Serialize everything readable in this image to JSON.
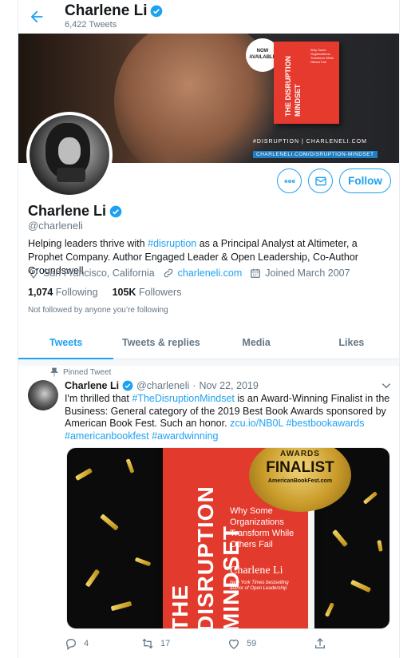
{
  "header": {
    "name": "Charlene Li",
    "tweet_count": "6,422 Tweets"
  },
  "banner": {
    "badge": "NOW AVAILABLE",
    "book_title": "THE DISRUPTION MINDSET",
    "book_subtitle": "Why Some Organizations Transform While Others Fail",
    "caption": "#DISRUPTION | CHARLENELI.COM",
    "link": "CHARLENELI.COM/DISRUPTION-MINDSET"
  },
  "profile": {
    "name": "Charlene Li",
    "handle": "@charleneli",
    "bio_before": "Helping leaders thrive with ",
    "bio_hashtag": "#disruption",
    "bio_after": " as a Principal Analyst at Altimeter, a Prophet Company. Author Engaged Leader & Open Leadership, Co-Author Groundswell",
    "location": "San Francisco, California",
    "website": "charleneli.com",
    "joined": "Joined March 2007",
    "following_count": "1,074",
    "following_label": "Following",
    "followers_count": "105K",
    "followers_label": "Followers",
    "not_followed": "Not followed by anyone you’re following",
    "follow_label": "Follow"
  },
  "tabs": [
    {
      "label": "Tweets",
      "active": true
    },
    {
      "label": "Tweets & replies",
      "active": false
    },
    {
      "label": "Media",
      "active": false
    },
    {
      "label": "Likes",
      "active": false
    }
  ],
  "tweet": {
    "pinned_label": "Pinned Tweet",
    "name": "Charlene Li",
    "handle": "@charleneli",
    "separator": "·",
    "date": "Nov 22, 2019",
    "text_1": "I'm thrilled that ",
    "hashtag_1": "#TheDisruptionMindset",
    "text_2": " is an Award-Winning Finalist in the Business: General category of the 2019 Best Book Awards sponsored by American Book Fest. Such an honor. ",
    "link": "zcu.io/NB0L",
    "space": " ",
    "hashtag_2": "#bestbookawards",
    "hashtag_3": "#americanbookfest",
    "hashtag_4": "#awardwinning",
    "media": {
      "title": "THE DISRUPTION MINDSET",
      "subtitle": "Why Some Organizations Transform While Others Fail",
      "author": "Charlene Li",
      "author_sub": "New York Times bestselling author of Open Leadership",
      "seal_top": "AWARDS",
      "seal_main": "FINALIST",
      "seal_site": "AmericanBookFest.com"
    },
    "reply_count": "4",
    "retweet_count": "17",
    "like_count": "59"
  },
  "colors": {
    "accent": "#1da1f2",
    "secondary_text": "#657786",
    "book_red": "#e23a2c"
  },
  "icons": {
    "back": "arrow-left-icon",
    "verified": "verified-badge-icon",
    "more": "more-dots-icon",
    "message": "envelope-icon",
    "location": "location-pin-icon",
    "link": "link-icon",
    "calendar": "calendar-icon",
    "pin": "pin-icon",
    "caret": "chevron-down-icon",
    "reply": "reply-icon",
    "retweet": "retweet-icon",
    "like": "heart-icon",
    "share": "share-icon"
  }
}
